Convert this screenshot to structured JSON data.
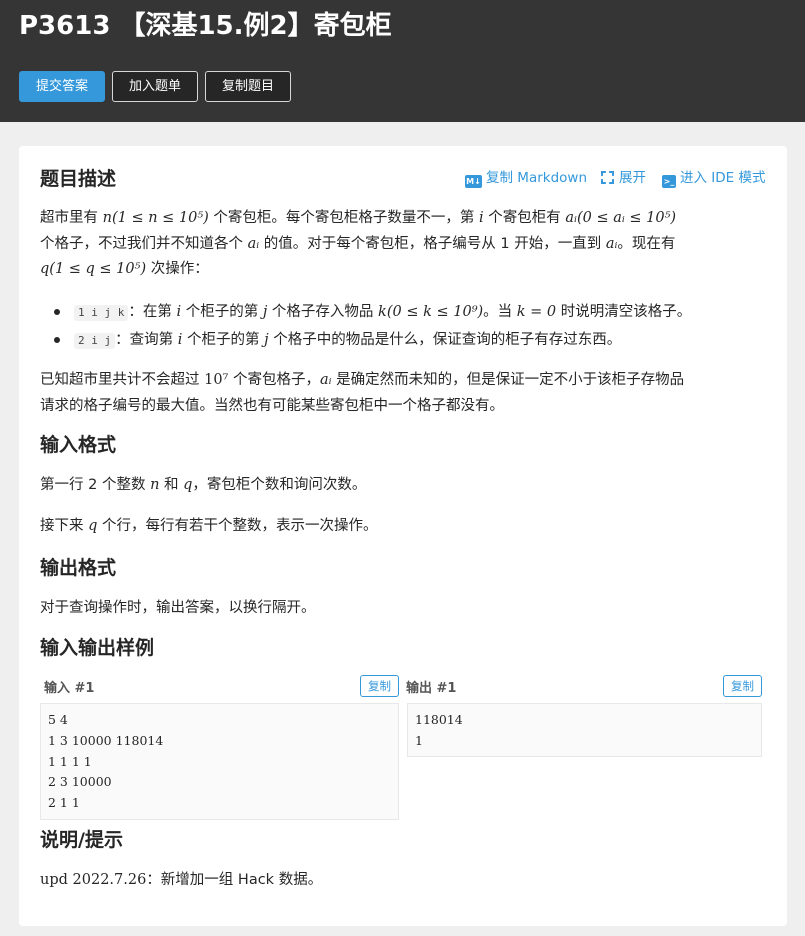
{
  "header": {
    "title": "P3613 【深基15.例2】寄包柜",
    "buttons": {
      "submit": "提交答案",
      "add_to_list": "加入题单",
      "copy_problem": "复制题目"
    }
  },
  "description": {
    "heading": "题目描述",
    "tools": {
      "copy_markdown": "复制 Markdown",
      "markdown_icon_text": "M↓",
      "expand": "展开",
      "ide": "进入 IDE 模式",
      "ide_icon_text": ">_"
    },
    "p1": {
      "t1": "超市里有 ",
      "m1": "n(1 ≤ n ≤ 10⁵)",
      "t2": " 个寄包柜。每个寄包柜格子数量不一，第 ",
      "m2": "i",
      "t3": " 个寄包柜有 ",
      "m3": "aᵢ(0 ≤ aᵢ ≤ 10⁵)",
      "t4": "个格子，不过我们并不知道各个 ",
      "m4": "aᵢ",
      "t5": " 的值。对于每个寄包柜，格子编号从 1 开始，一直到 ",
      "m5": "aᵢ",
      "t6": "。现在有",
      "m6": "q(1 ≤ q ≤ 10⁵)",
      "t7": " 次操作："
    },
    "ops": [
      {
        "code": "1 i j k",
        "t1": "：在第 ",
        "m1": "i",
        "t2": " 个柜子的第 ",
        "m2": "j",
        "t3": " 个格子存入物品 ",
        "m3": "k(0 ≤ k ≤ 10⁹)",
        "t4": "。当 ",
        "m4": "k = 0",
        "t5": " 时说明清空该格子。"
      },
      {
        "code": "2 i j",
        "t1": "：查询第 ",
        "m1": "i",
        "t2": " 个柜子的第 ",
        "m2": "j",
        "t3": " 个格子中的物品是什么，保证查询的柜子有存过东西。"
      }
    ],
    "p2": {
      "t1": "已知超市里共计不会超过 ",
      "m1": "10⁷",
      "t2": " 个寄包格子，",
      "m2": "aᵢ",
      "t3": " 是确定然而未知的，但是保证一定不小于该柜子存物品",
      "t4": "请求的格子编号的最大值。当然也有可能某些寄包柜中一个格子都没有。"
    }
  },
  "input_format": {
    "heading": "输入格式",
    "p1": {
      "t1": "第一行 2 个整数 ",
      "m1": "n",
      "t2": " 和 ",
      "m2": "q",
      "t3": "，寄包柜个数和询问次数。"
    },
    "p2": {
      "t1": "接下来 ",
      "m1": "q",
      "t2": " 个行，每行有若干个整数，表示一次操作。"
    }
  },
  "output_format": {
    "heading": "输出格式",
    "p1": "对于查询操作时，输出答案，以换行隔开。"
  },
  "samples": {
    "heading": "输入输出样例",
    "input_label": "输入 #1",
    "output_label": "输出 #1",
    "copy_label": "复制",
    "input_lines": [
      "5 4",
      "1 3 10000 118014",
      "1 1 1 1",
      "2 3 10000",
      "2 1 1"
    ],
    "output_lines": [
      "118014",
      "1"
    ]
  },
  "hint": {
    "heading": "说明/提示",
    "m1": "upd 2022.7.26",
    "t1": "：新增加一组 Hack 数据。"
  }
}
